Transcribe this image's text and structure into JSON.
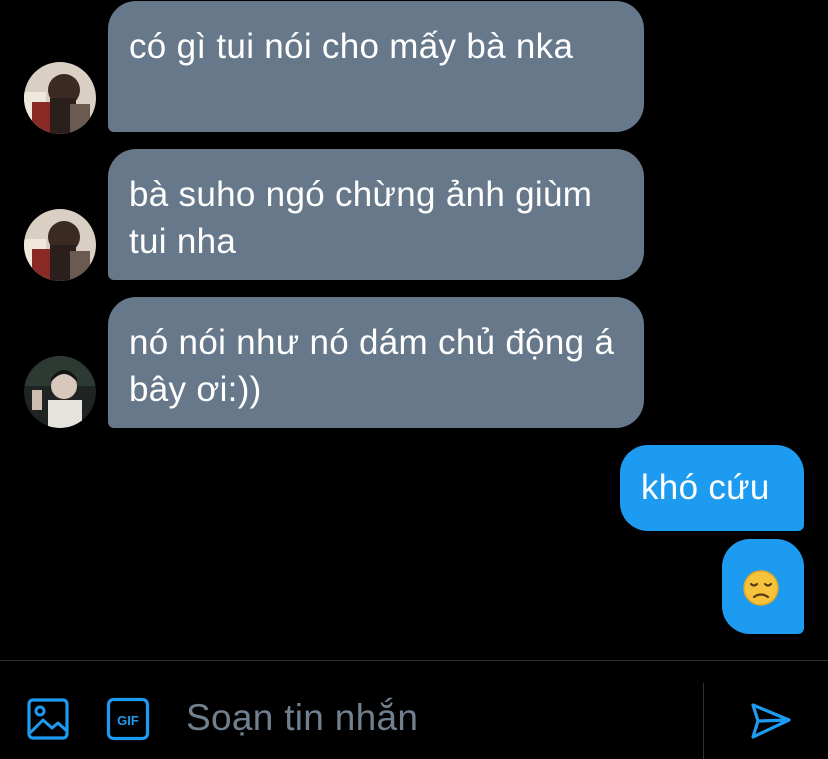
{
  "messages": [
    {
      "direction": "incoming",
      "avatar": "avatar-user-a",
      "text": "có gì tui nói cho mấy bà nka"
    },
    {
      "direction": "incoming",
      "avatar": "avatar-user-a",
      "text": "bà suho ngó chừng ảnh giùm tui nha"
    },
    {
      "direction": "incoming",
      "avatar": "avatar-user-b",
      "text": "nó nói như nó dám chủ động á bây ơi:))"
    },
    {
      "direction": "outgoing",
      "text": "khó cứu"
    },
    {
      "direction": "outgoing",
      "text": "😞"
    }
  ],
  "composer": {
    "placeholder": "Soạn tin nhắn",
    "gif_label": "GIF"
  },
  "colors": {
    "incoming_bubble": "#66788a",
    "outgoing_bubble": "#1d9bf0",
    "accent": "#1d9bf0",
    "background": "#000000"
  }
}
